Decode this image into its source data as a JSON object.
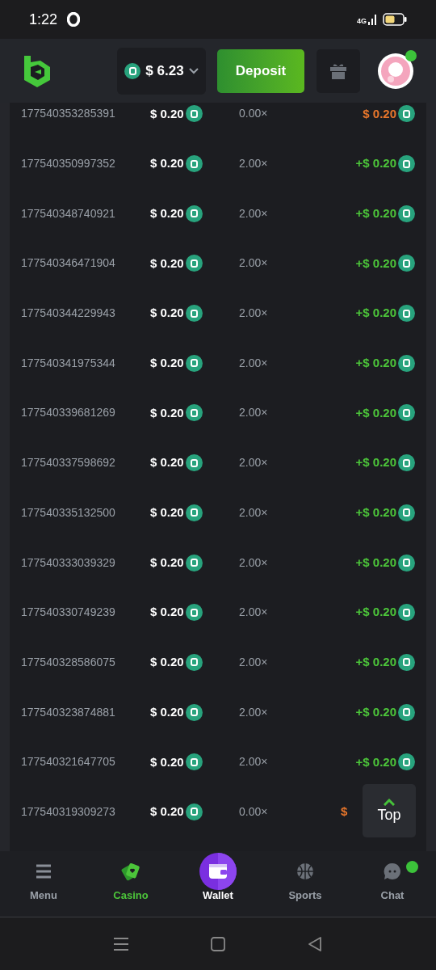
{
  "status_bar": {
    "time": "1:22",
    "network": "4G"
  },
  "header": {
    "balance": "$ 6.23",
    "deposit": "Deposit",
    "online": true
  },
  "bets": [
    {
      "id": "177540353285391",
      "bet": "$ 0.20",
      "multiplier": "0.00×",
      "payout": "$ 0.20",
      "color": "#e8762b"
    },
    {
      "id": "177540350997352",
      "bet": "$ 0.20",
      "multiplier": "2.00×",
      "payout": "+$ 0.20",
      "color": "#4cc53a"
    },
    {
      "id": "177540348740921",
      "bet": "$ 0.20",
      "multiplier": "2.00×",
      "payout": "+$ 0.20",
      "color": "#4cc53a"
    },
    {
      "id": "177540346471904",
      "bet": "$ 0.20",
      "multiplier": "2.00×",
      "payout": "+$ 0.20",
      "color": "#4cc53a"
    },
    {
      "id": "177540344229943",
      "bet": "$ 0.20",
      "multiplier": "2.00×",
      "payout": "+$ 0.20",
      "color": "#4cc53a"
    },
    {
      "id": "177540341975344",
      "bet": "$ 0.20",
      "multiplier": "2.00×",
      "payout": "+$ 0.20",
      "color": "#4cc53a"
    },
    {
      "id": "177540339681269",
      "bet": "$ 0.20",
      "multiplier": "2.00×",
      "payout": "+$ 0.20",
      "color": "#4cc53a"
    },
    {
      "id": "177540337598692",
      "bet": "$ 0.20",
      "multiplier": "2.00×",
      "payout": "+$ 0.20",
      "color": "#4cc53a"
    },
    {
      "id": "177540335132500",
      "bet": "$ 0.20",
      "multiplier": "2.00×",
      "payout": "+$ 0.20",
      "color": "#4cc53a"
    },
    {
      "id": "177540333039329",
      "bet": "$ 0.20",
      "multiplier": "2.00×",
      "payout": "+$ 0.20",
      "color": "#4cc53a"
    },
    {
      "id": "177540330749239",
      "bet": "$ 0.20",
      "multiplier": "2.00×",
      "payout": "+$ 0.20",
      "color": "#4cc53a"
    },
    {
      "id": "177540328586075",
      "bet": "$ 0.20",
      "multiplier": "2.00×",
      "payout": "+$ 0.20",
      "color": "#4cc53a"
    },
    {
      "id": "177540323874881",
      "bet": "$ 0.20",
      "multiplier": "2.00×",
      "payout": "+$ 0.20",
      "color": "#4cc53a"
    },
    {
      "id": "177540321647705",
      "bet": "$ 0.20",
      "multiplier": "2.00×",
      "payout": "+$ 0.20",
      "color": "#4cc53a"
    },
    {
      "id": "177540319309273",
      "bet": "$ 0.20",
      "multiplier": "0.00×",
      "payout": "$",
      "color": "#e8762b",
      "payout_coin": false
    }
  ],
  "top_button": "Top",
  "bottom_nav": [
    {
      "label": "Menu",
      "kind": "menu",
      "selected": false
    },
    {
      "label": "Casino",
      "kind": "casino",
      "selected": true
    },
    {
      "label": "Wallet",
      "kind": "wallet",
      "selected": false
    },
    {
      "label": "Sports",
      "kind": "sports",
      "selected": false
    },
    {
      "label": "Chat",
      "kind": "chat",
      "selected": false,
      "badge": true
    }
  ]
}
